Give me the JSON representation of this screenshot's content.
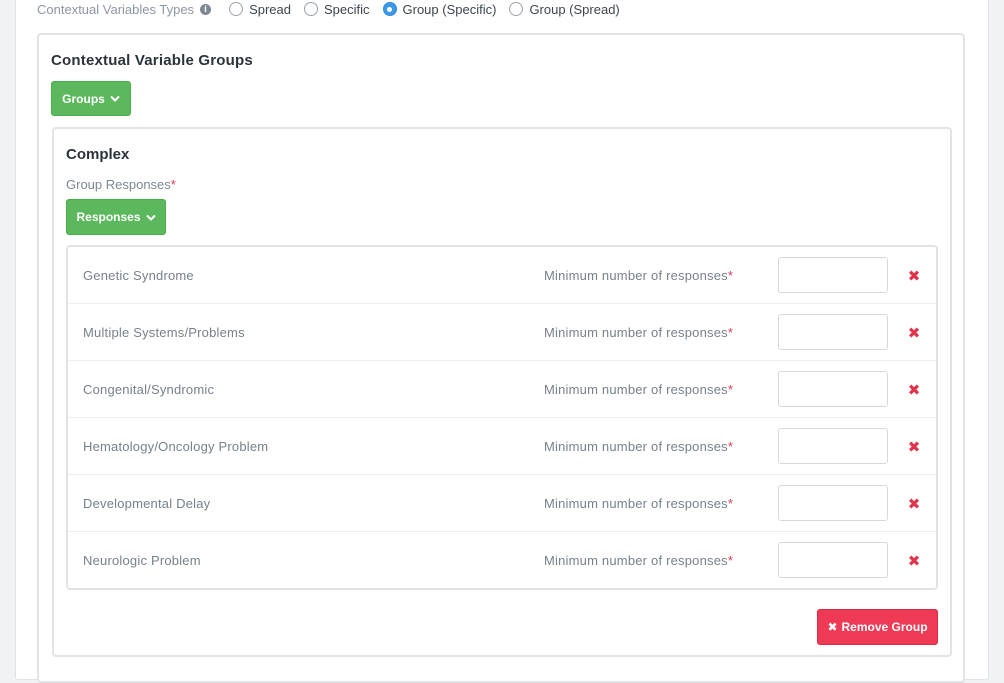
{
  "contextual_types": {
    "label": "Contextual Variables Types",
    "info_icon": "info-icon",
    "options": [
      {
        "label": "Spread",
        "checked": false
      },
      {
        "label": "Specific",
        "checked": false
      },
      {
        "label": "Group (Specific)",
        "checked": true
      },
      {
        "label": "Group (Spread)",
        "checked": false
      }
    ]
  },
  "groups_section": {
    "title": "Contextual Variable Groups",
    "groups_button": "Groups"
  },
  "group": {
    "title": "Complex",
    "responses_label": "Group Responses",
    "required_mark": "*",
    "responses_button": "Responses",
    "rows": [
      {
        "name": "Genetic Syndrome",
        "min_label": "Minimum number of responses",
        "value": ""
      },
      {
        "name": "Multiple Systems/Problems",
        "min_label": "Minimum number of responses",
        "value": ""
      },
      {
        "name": "Congenital/Syndromic",
        "min_label": "Minimum number of responses",
        "value": ""
      },
      {
        "name": "Hematology/Oncology Problem",
        "min_label": "Minimum number of responses",
        "value": ""
      },
      {
        "name": "Developmental Delay",
        "min_label": "Minimum number of responses",
        "value": ""
      },
      {
        "name": "Neurologic Problem",
        "min_label": "Minimum number of responses",
        "value": ""
      }
    ],
    "remove_icon": "✖",
    "remove_group_button": "Remove Group"
  },
  "colors": {
    "success": "#5cb85c",
    "danger": "#ee3a55",
    "radio_selected": "#3d97ea"
  }
}
